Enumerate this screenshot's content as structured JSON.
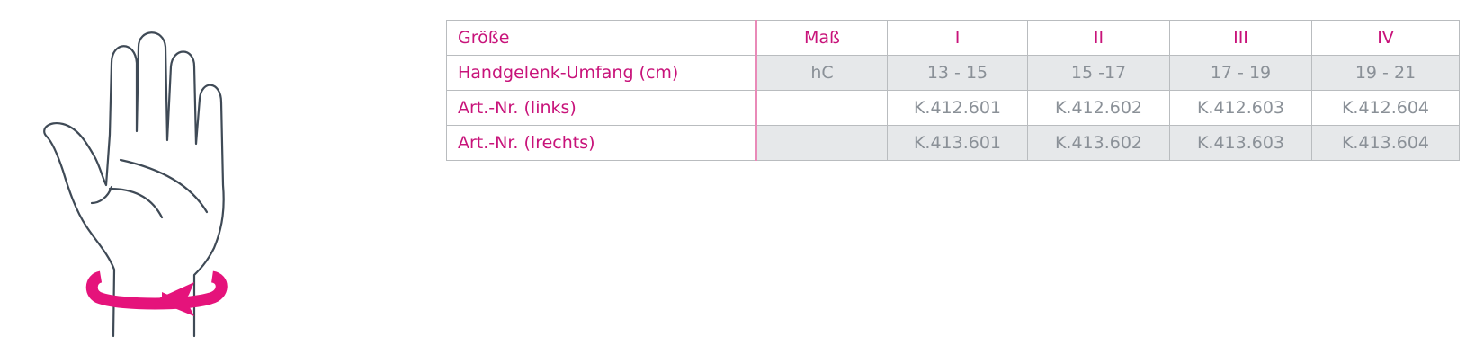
{
  "colors": {
    "accent": "#c8137a",
    "accent_border": "#e98ab8",
    "value_text": "#8a9097",
    "shade": "#e6e8ea",
    "grid": "#b9bcbf",
    "outline": "#3f4a56"
  },
  "illustration": {
    "icon": "hand-wrist-measure-icon",
    "arrow_icon": "circular-arrow-icon"
  },
  "table": {
    "header": {
      "label": "Größe",
      "measure": "Maß",
      "sizes": [
        "I",
        "II",
        "III",
        "IV"
      ]
    },
    "rows": [
      {
        "label": "Handgelenk-Umfang (cm)",
        "measure": "hC",
        "values": [
          "13 - 15",
          "15 -17",
          "17 - 19",
          "19 - 21"
        ]
      },
      {
        "label": "Art.-Nr. (links)",
        "measure": "",
        "values": [
          "K.412.601",
          "K.412.602",
          "K.412.603",
          "K.412.604"
        ]
      },
      {
        "label": "Art.-Nr. (lrechts)",
        "measure": "",
        "values": [
          "K.413.601",
          "K.413.602",
          "K.413.603",
          "K.413.604"
        ]
      }
    ]
  }
}
